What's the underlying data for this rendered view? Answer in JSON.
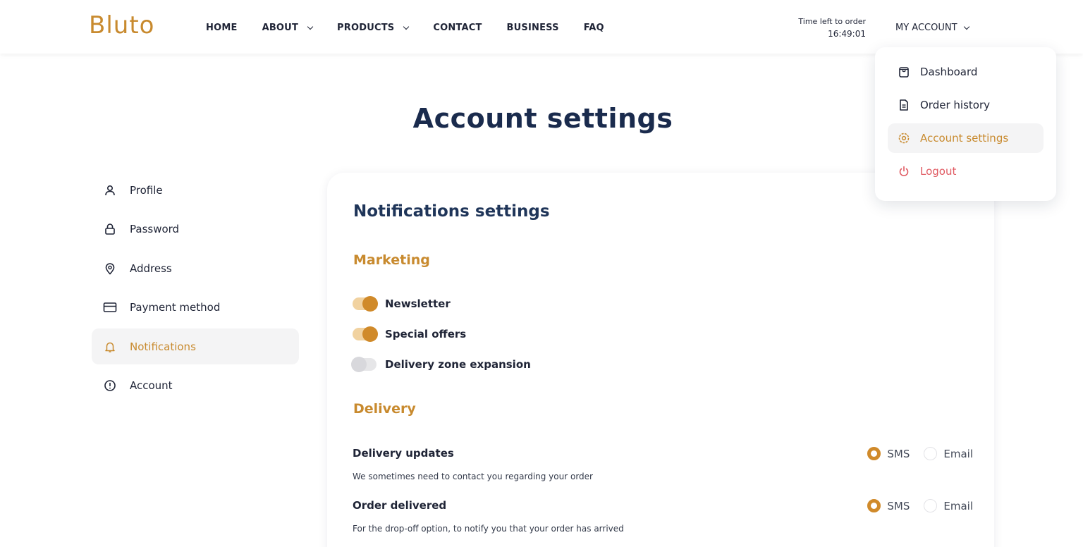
{
  "brand": {
    "logo_text": "Bluto",
    "accent": "#c88a2e",
    "navy": "#1a2b4d"
  },
  "nav": {
    "items": [
      {
        "label": "HOME",
        "dropdown": false
      },
      {
        "label": "ABOUT",
        "dropdown": true
      },
      {
        "label": "PRODUCTS",
        "dropdown": true
      },
      {
        "label": "CONTACT",
        "dropdown": false
      },
      {
        "label": "BUSINESS",
        "dropdown": false
      },
      {
        "label": "FAQ",
        "dropdown": false
      }
    ]
  },
  "timer": {
    "label": "Time left to order",
    "value": "16:49:01"
  },
  "account_menu": {
    "label": "MY ACCOUNT",
    "items": [
      {
        "label": "Dashboard",
        "icon": "bag-icon"
      },
      {
        "label": "Order history",
        "icon": "document-icon"
      },
      {
        "label": "Account settings",
        "icon": "gear-icon",
        "active": true
      },
      {
        "label": "Logout",
        "icon": "power-icon"
      }
    ]
  },
  "page": {
    "title": "Account settings"
  },
  "sidebar": {
    "items": [
      {
        "label": "Profile",
        "icon": "user-icon"
      },
      {
        "label": "Password",
        "icon": "lock-icon"
      },
      {
        "label": "Address",
        "icon": "location-pin-icon"
      },
      {
        "label": "Payment method",
        "icon": "credit-card-icon"
      },
      {
        "label": "Notifications",
        "icon": "bell-icon",
        "active": true
      },
      {
        "label": "Account",
        "icon": "info-circle-icon"
      }
    ]
  },
  "notifications": {
    "title": "Notifications settings",
    "marketing": {
      "title": "Marketing",
      "toggles": [
        {
          "label": "Newsletter",
          "on": true
        },
        {
          "label": "Special offers",
          "on": true
        },
        {
          "label": "Delivery zone expansion",
          "on": false
        }
      ]
    },
    "delivery": {
      "title": "Delivery",
      "rows": [
        {
          "label": "Delivery updates",
          "description": "We sometimes need to contact you regarding your order",
          "option_sms": "SMS",
          "option_email": "Email",
          "selected": "SMS"
        },
        {
          "label": "Order delivered",
          "description": "For the drop-off option, to notify you that your order has arrived",
          "option_sms": "SMS",
          "option_email": "Email",
          "selected": "SMS"
        }
      ]
    }
  }
}
